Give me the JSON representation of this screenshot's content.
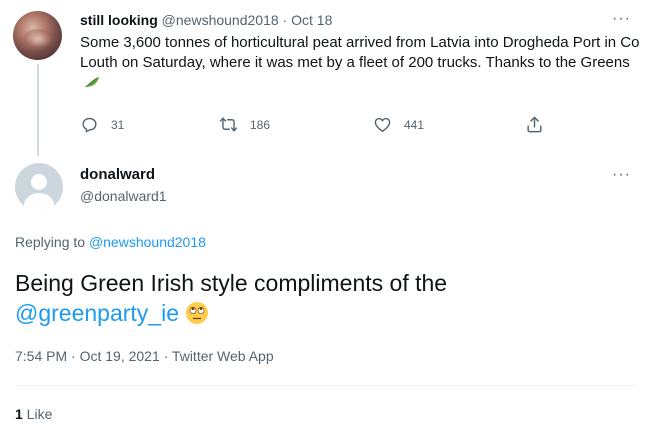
{
  "parent_tweet": {
    "name": "still looking",
    "handle": "@newshound2018",
    "separator": "·",
    "date": "Oct 18",
    "more": "···",
    "text": "Some 3,600 tonnes of horticultural peat arrived from Latvia into Drogheda Port in Co Louth on Saturday, where it was met by a fleet of 200 trucks. Thanks to the Greens",
    "emoji_icon": "leafy-green-icon",
    "actions": {
      "replies": "31",
      "retweets": "186",
      "likes": "441"
    }
  },
  "main_tweet": {
    "name": "donalward",
    "handle": "@donalward1",
    "more": "···",
    "replying_prefix": "Replying to ",
    "replying_to": "@newshound2018",
    "text_before": "Being Green Irish style compliments of the",
    "mention": "@greenparty_ie",
    "emoji_icon": "face-with-rolling-eyes-icon",
    "timestamp": "7:54 PM · Oct 19, 2021 · Twitter Web App",
    "like_count": "1",
    "like_label": " Like"
  },
  "colors": {
    "text": "#0f1419",
    "secondary": "#536471",
    "link": "#1d9bf0",
    "divider": "#eff3f4"
  }
}
